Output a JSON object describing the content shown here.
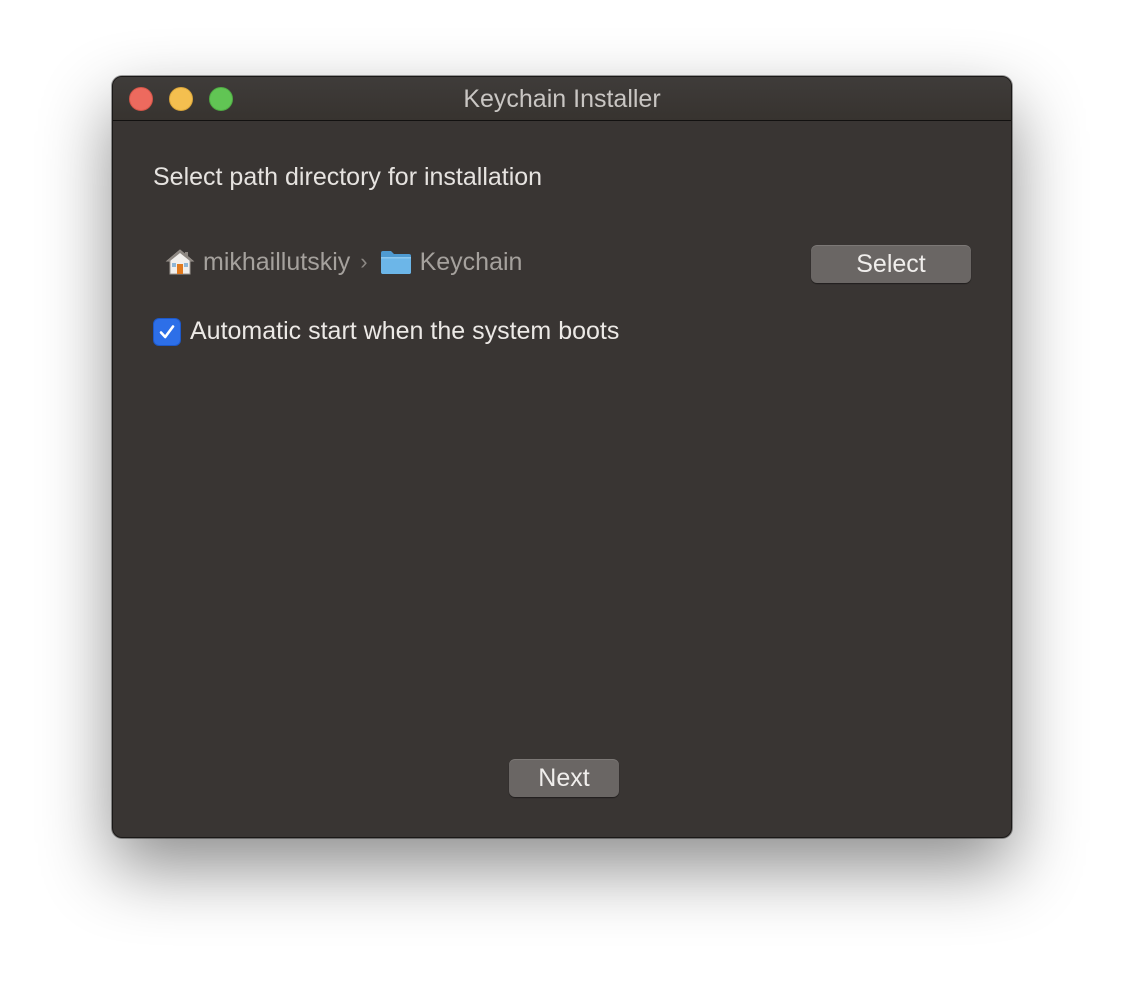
{
  "window": {
    "title": "Keychain Installer"
  },
  "main": {
    "heading": "Select path directory for installation",
    "path": {
      "segments": [
        {
          "label": "mikhaillutskiy",
          "icon": "home-icon"
        },
        {
          "label": "Keychain",
          "icon": "folder-icon"
        }
      ],
      "separator": "›"
    },
    "select_button_label": "Select",
    "autostart": {
      "label": "Automatic start when the system boots",
      "checked": true
    },
    "next_button_label": "Next"
  },
  "colors": {
    "window_bg": "#393533",
    "close": "#ed6a5e",
    "minimize": "#f4bf4f",
    "zoom": "#61c554",
    "checkbox_accent": "#2d6fe8",
    "button_bg": "#6a6664"
  }
}
